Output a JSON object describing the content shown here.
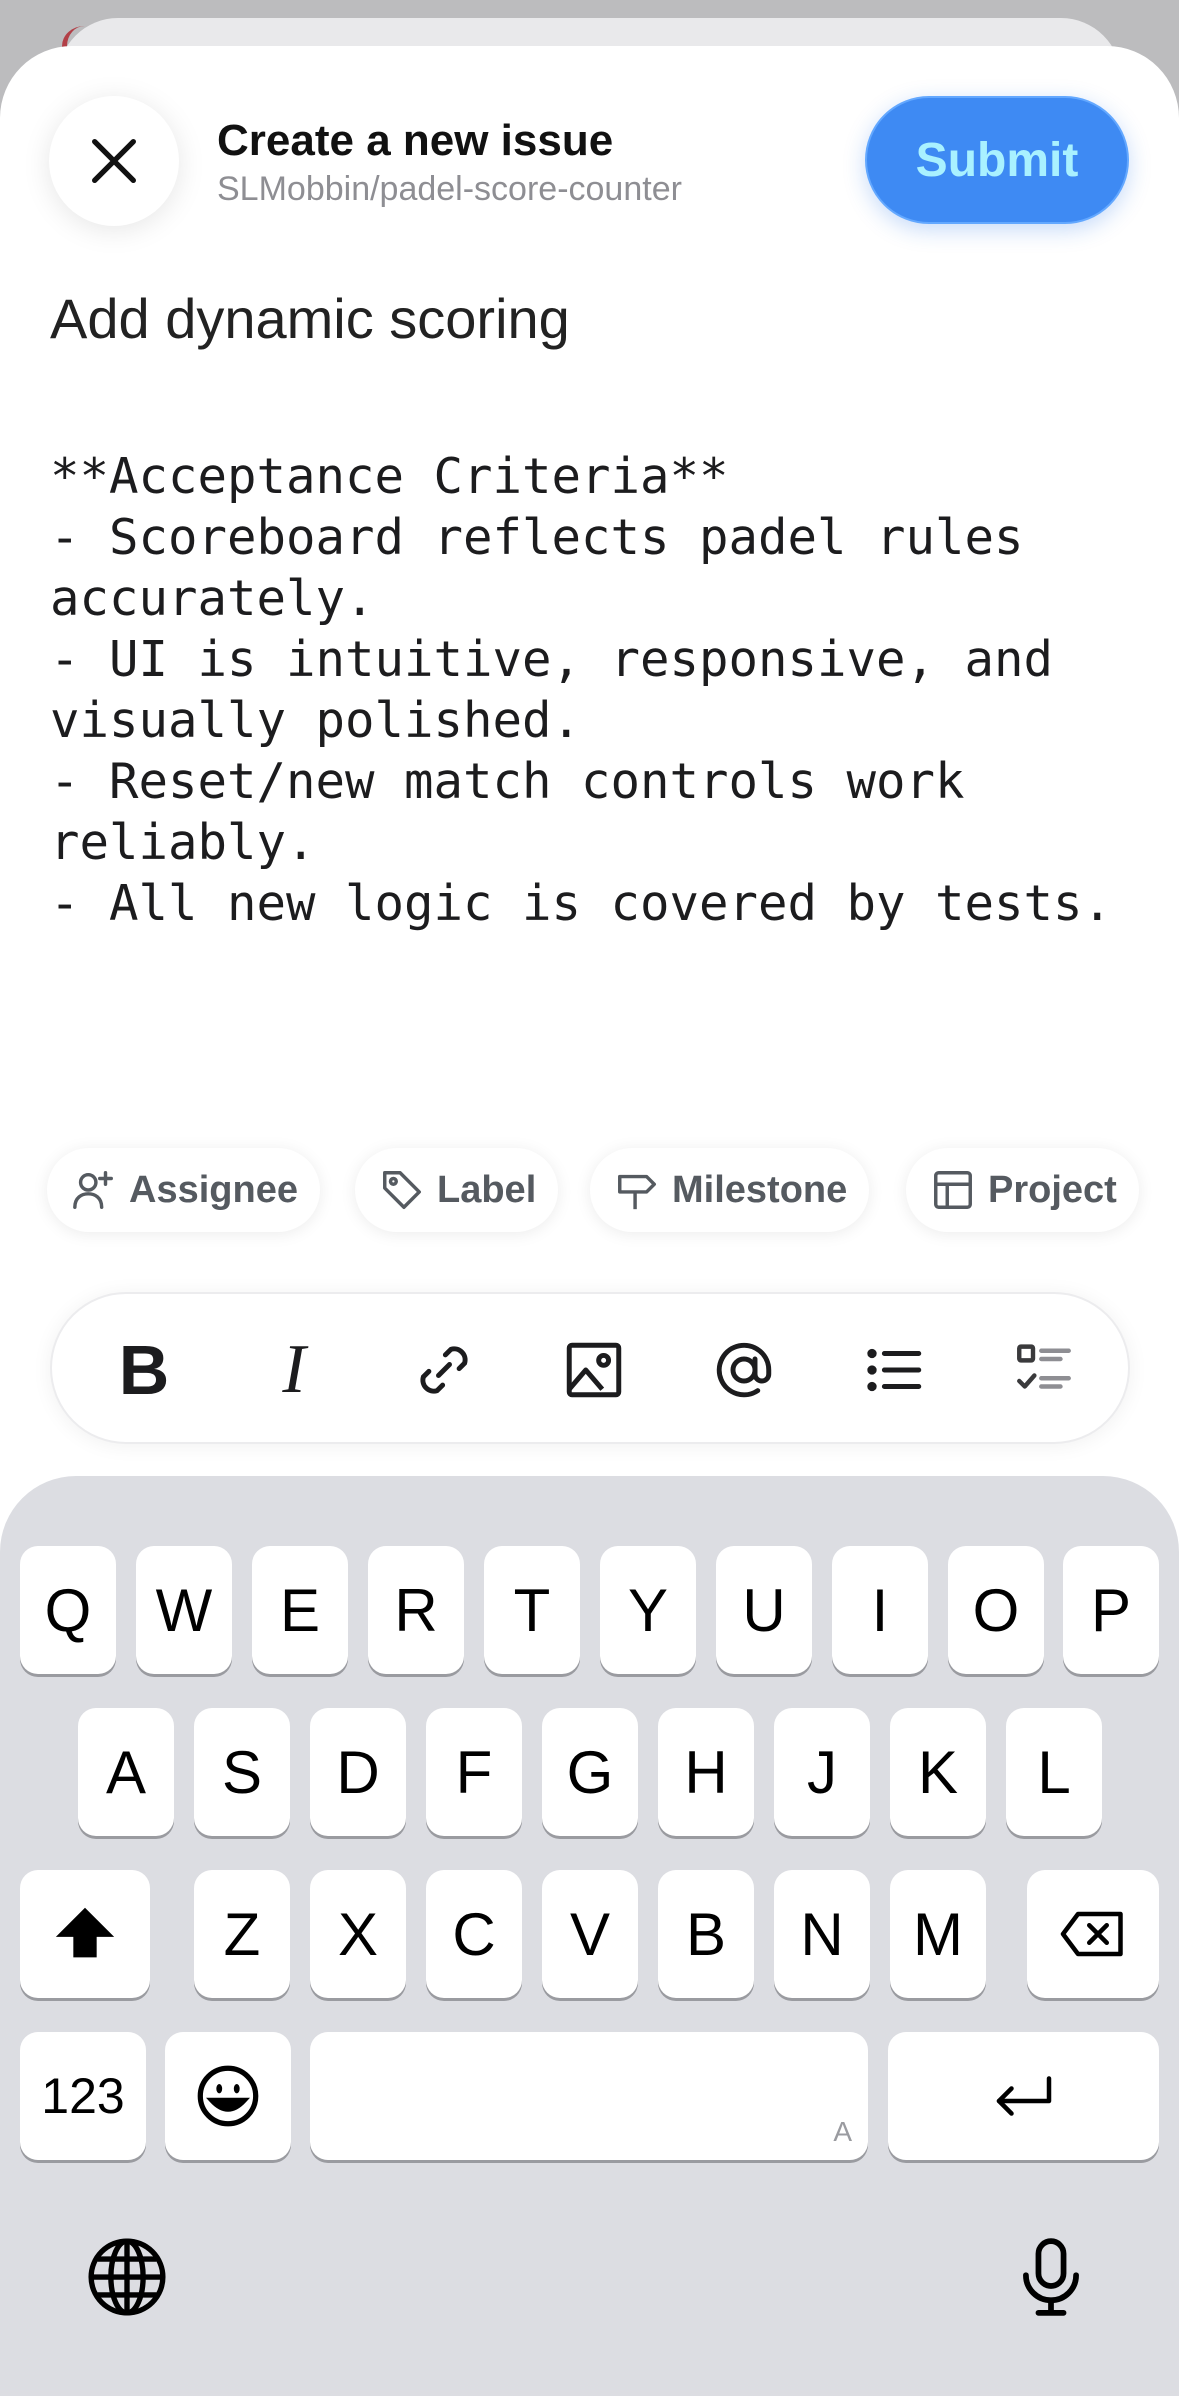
{
  "header": {
    "title": "Create a new issue",
    "repo": "SLMobbin/padel-score-counter",
    "submit_label": "Submit",
    "close_icon": "close-icon"
  },
  "issue": {
    "title": "Add dynamic scoring",
    "body": "**Acceptance Criteria**\n- Scoreboard reflects padel rules accurately.\n- UI is intuitive, responsive, and visually polished.\n- Reset/new match controls work reliably.\n- All new logic is covered by tests."
  },
  "chips": [
    {
      "label": "Assignee",
      "icon": "person-add-icon"
    },
    {
      "label": "Label",
      "icon": "tag-icon"
    },
    {
      "label": "Milestone",
      "icon": "milestone-icon"
    },
    {
      "label": "Project",
      "icon": "table-icon"
    }
  ],
  "format_toolbar": {
    "bold": "B",
    "italic": "I",
    "items": [
      "bold-icon",
      "italic-icon",
      "link-icon",
      "image-icon",
      "mention-icon",
      "bulleted-list-icon",
      "task-list-icon"
    ]
  },
  "keyboard": {
    "row1": [
      "Q",
      "W",
      "E",
      "R",
      "T",
      "Y",
      "U",
      "I",
      "O",
      "P"
    ],
    "row2": [
      "A",
      "S",
      "D",
      "F",
      "G",
      "H",
      "J",
      "K",
      "L"
    ],
    "row3": [
      "Z",
      "X",
      "C",
      "V",
      "B",
      "N",
      "M"
    ],
    "numbers_label": "123",
    "space_corner": "A",
    "icons": [
      "shift-icon",
      "delete-icon",
      "emoji-icon",
      "return-icon",
      "globe-icon",
      "microphone-icon"
    ]
  },
  "colors": {
    "accent": "#3e8af3",
    "submit_text": "#a9f1ff",
    "keyboard_bg": "#dcdde2",
    "chip_text": "#555a60"
  }
}
